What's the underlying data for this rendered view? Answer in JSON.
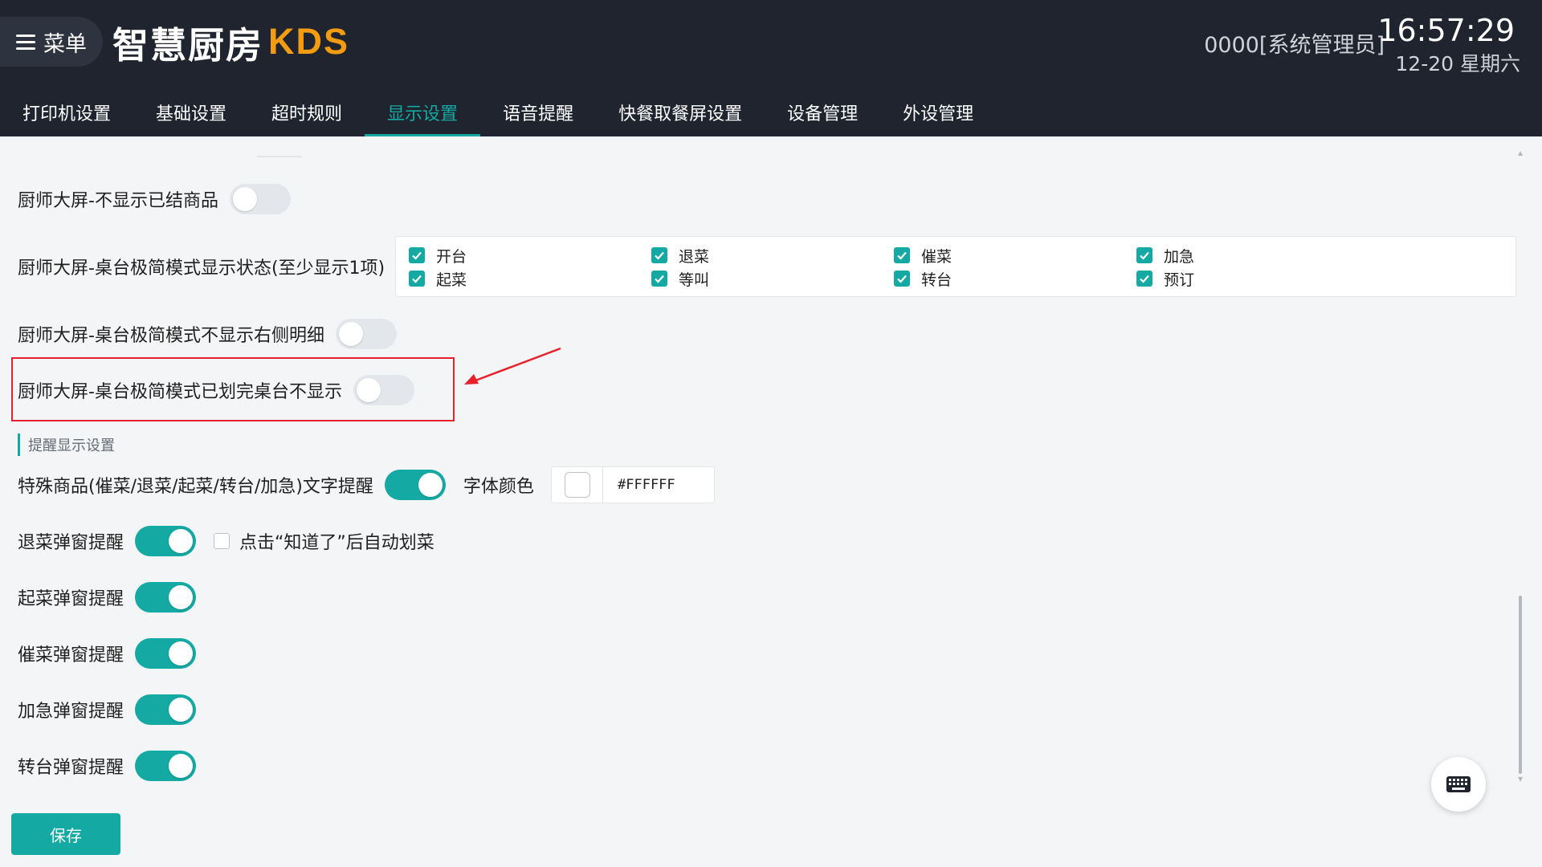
{
  "header": {
    "menu_label": "菜单",
    "logo_cn": "智慧厨房",
    "logo_en": "KDS",
    "user": "0000[系统管理员]",
    "time": "16:57:29",
    "date": "12-20 星期六"
  },
  "tabs": [
    {
      "label": "打印机设置",
      "active": false
    },
    {
      "label": "基础设置",
      "active": false
    },
    {
      "label": "超时规则",
      "active": false
    },
    {
      "label": "显示设置",
      "active": true
    },
    {
      "label": "语音提醒",
      "active": false
    },
    {
      "label": "快餐取餐屏设置",
      "active": false
    },
    {
      "label": "设备管理",
      "active": false
    },
    {
      "label": "外设管理",
      "active": false
    }
  ],
  "settings": {
    "hide_settled": {
      "label": "厨师大屏-不显示已结商品",
      "on": false
    },
    "table_status": {
      "label": "厨师大屏-桌台极简模式显示状态(至少显示1项)",
      "options": [
        "开台",
        "退菜",
        "催菜",
        "加急",
        "起菜",
        "等叫",
        "转台",
        "预订"
      ]
    },
    "hide_right_detail": {
      "label": "厨师大屏-桌台极简模式不显示右侧明细",
      "on": false
    },
    "hide_finished_table": {
      "label": "厨师大屏-桌台极简模式已划完桌台不显示",
      "on": false
    }
  },
  "reminder": {
    "section_title": "提醒显示设置",
    "special_text": {
      "label": "特殊商品(催菜/退菜/起菜/转台/加急)文字提醒",
      "on": true
    },
    "font_color_label": "字体颜色",
    "font_color_value": "#FFFFFF",
    "return_popup": {
      "label": "退菜弹窗提醒",
      "on": true
    },
    "auto_mark_label": "点击“知道了”后自动划菜",
    "start_popup": {
      "label": "起菜弹窗提醒",
      "on": true
    },
    "rush_popup": {
      "label": "催菜弹窗提醒",
      "on": true
    },
    "urgent_popup": {
      "label": "加急弹窗提醒",
      "on": true
    },
    "transfer_popup": {
      "label": "转台弹窗提醒",
      "on": true
    }
  },
  "save_label": "保存",
  "icons": {
    "menu": "hamburger-icon",
    "keyboard": "keyboard-icon",
    "check": "check-icon",
    "arrow": "annotation-arrow-icon"
  },
  "colors": {
    "accent": "#14a9a3",
    "header_bg": "#1f242e",
    "logo_accent": "#f39c12",
    "highlight": "#e8202a"
  }
}
